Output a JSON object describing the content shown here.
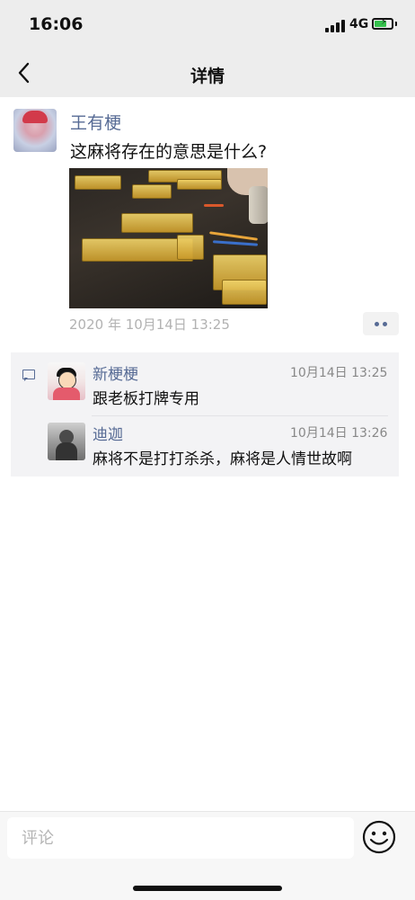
{
  "status_bar": {
    "time": "16:06",
    "network": "4G"
  },
  "nav": {
    "title": "详情"
  },
  "post": {
    "author": "王有梗",
    "text": "这麻将存在的意思是什么?",
    "timestamp": "2020 年 10月14日 13:25"
  },
  "comments": [
    {
      "name": "新梗梗",
      "time": "10月14日 13:25",
      "text": "跟老板打牌专用"
    },
    {
      "name": "迪迦",
      "time": "10月14日 13:26",
      "text": "麻将不是打打杀杀，麻将是人情世故啊"
    }
  ],
  "input": {
    "placeholder": "评论"
  },
  "colors": {
    "link_blue": "#576b95",
    "background_gray": "#ededed",
    "battery_green": "#35c14d"
  }
}
